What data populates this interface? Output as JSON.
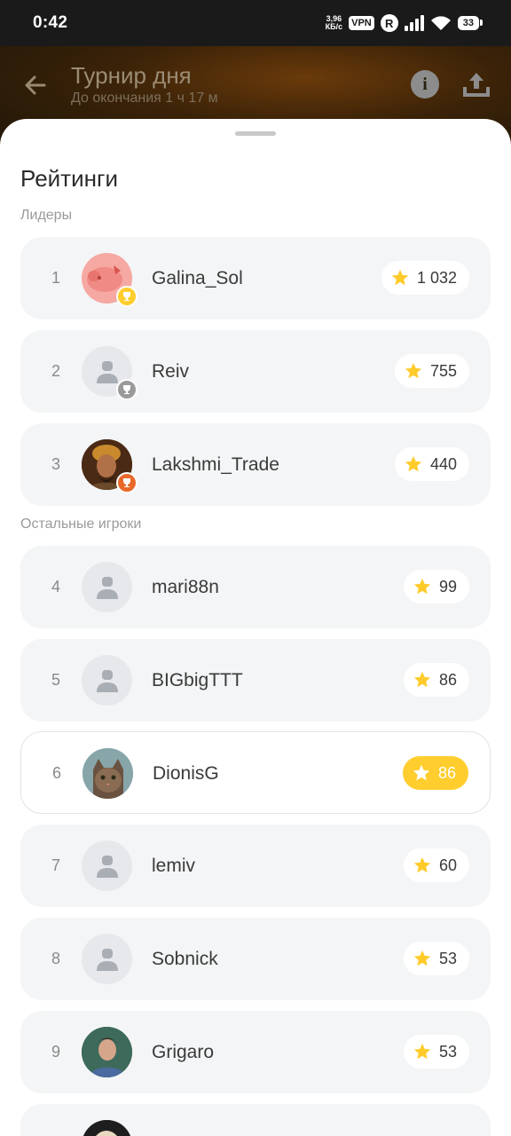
{
  "status": {
    "time": "0:42",
    "net_speed_value": "3,96",
    "net_speed_unit": "КБ/с",
    "vpn": "VPN",
    "r_badge": "R",
    "battery": "33"
  },
  "header": {
    "title": "Турнир дня",
    "subtitle": "До окончания 1 ч 17 м",
    "back_icon": "arrow-left-icon",
    "info_icon": "info-icon",
    "info_glyph": "i",
    "share_icon": "share-upload-icon"
  },
  "sheet": {
    "title": "Рейтинги",
    "leaders_label": "Лидеры",
    "others_label": "Остальные игроки"
  },
  "colors": {
    "gold": "#ffce2e",
    "silver": "#9a9a9a",
    "bronze": "#e8682a",
    "row_bg": "#f4f5f6"
  },
  "leaders": [
    {
      "rank": "1",
      "name": "Galina_Sol",
      "score": "1 032",
      "medal": "gold"
    },
    {
      "rank": "2",
      "name": "Reiv",
      "score": "755",
      "medal": "silver"
    },
    {
      "rank": "3",
      "name": "Lakshmi_Trade",
      "score": "440",
      "medal": "bronze"
    }
  ],
  "others": [
    {
      "rank": "4",
      "name": "mari88n",
      "score": "99"
    },
    {
      "rank": "5",
      "name": "BIGbigTTT",
      "score": "86"
    },
    {
      "rank": "6",
      "name": "DionisG",
      "score": "86",
      "current_user": true
    },
    {
      "rank": "7",
      "name": "lemiv",
      "score": "60"
    },
    {
      "rank": "8",
      "name": "Sobnick",
      "score": "53"
    },
    {
      "rank": "9",
      "name": "Grigaro",
      "score": "53"
    }
  ]
}
